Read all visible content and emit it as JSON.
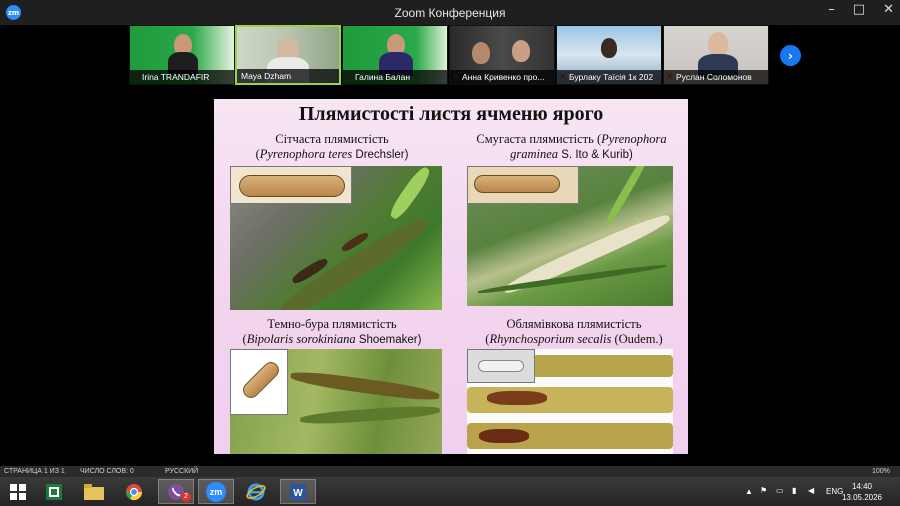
{
  "window": {
    "title": "Zoom Конференция",
    "app_badge": "zm",
    "minimize": "–",
    "maximize": "□",
    "close": "✕"
  },
  "participants": [
    {
      "name": "Irina TRANDAFIR",
      "muted": true,
      "active": false
    },
    {
      "name": "Maya Dzham",
      "muted": false,
      "active": true
    },
    {
      "name": "Галина Балан",
      "muted": true,
      "active": false
    },
    {
      "name": "Анна Кривенко про...",
      "muted": true,
      "active": false
    },
    {
      "name": "Бурлаку Таїсія 1к 202",
      "muted": true,
      "active": false
    },
    {
      "name": "Руслан Соломонов",
      "muted": true,
      "active": false
    }
  ],
  "next_page_icon": "›",
  "slide": {
    "title": "Плямистості листя ячменю ярого",
    "captions": {
      "tl_line1": "Сітчаста плямистість",
      "tl_line2_open": "(",
      "tl_line2_italic": "Pyrenophora teres",
      "tl_line2_rest": " Drechsler)",
      "tr_line1_text": "Смугаста плямистість (",
      "tr_line1_italic": "Pyrenophora",
      "tr_line2_italic": "graminea",
      "tr_line2_rest": " S. Ito & Kurib)",
      "bl_line1": "Темно-бура плямистість",
      "bl_line2_open": "(",
      "bl_line2_italic": "Bipolaris sorokiniana",
      "bl_line2_rest": " Shoemaker)",
      "br_line1": "Облямівкова плямистість",
      "br_line2_open": "(",
      "br_line2_italic": "Rhynchosporium secalis",
      "br_line2_rest": " (Oudem.)"
    }
  },
  "status_bar": {
    "page": "СТРАНИЦА 1 ИЗ 1",
    "words": "ЧИСЛО СЛОВ: 0",
    "lang": "РУССКИЙ",
    "zoom": "100%"
  },
  "taskbar": {
    "apps": [
      "start",
      "excel",
      "file-explorer",
      "chrome",
      "viber",
      "zoom",
      "internet-explorer",
      "word"
    ],
    "zoom_label": "zm",
    "viber_badge": "2",
    "input_lang": "ENG",
    "time": "14:40",
    "date": "13.05.2026"
  }
}
